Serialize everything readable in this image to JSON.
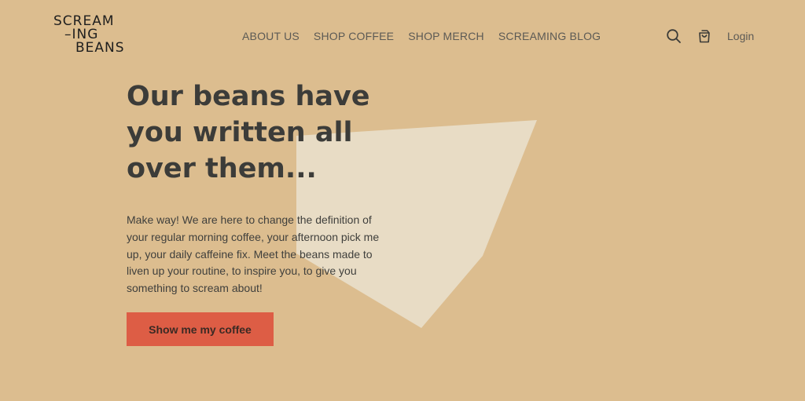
{
  "brand": {
    "logo_line1": "SCREAM",
    "logo_line2": "–ING",
    "logo_line3": "BEANS"
  },
  "nav": {
    "items": [
      {
        "label": "ABOUT US"
      },
      {
        "label": "SHOP COFFEE"
      },
      {
        "label": "SHOP MERCH"
      },
      {
        "label": "SCREAMING BLOG"
      }
    ]
  },
  "header": {
    "icons": [
      "search-icon",
      "cart-icon"
    ],
    "login_label": "Login"
  },
  "hero": {
    "title_line1": "Our beans have",
    "title_line2": "you written all",
    "title_line3": "over them...",
    "body": "Make way! We are here to change the definition of your regular morning coffee, your afternoon pick me up, your daily caffeine fix. Meet the beans made to liven up your routine, to inspire you, to give you something to scream about!",
    "cta_label": "Show me my coffee"
  },
  "colors": {
    "background": "#dcbd8f",
    "decor_shape": "#e8dcc5",
    "cta": "#dd5d45",
    "text": "#3c3c39"
  }
}
